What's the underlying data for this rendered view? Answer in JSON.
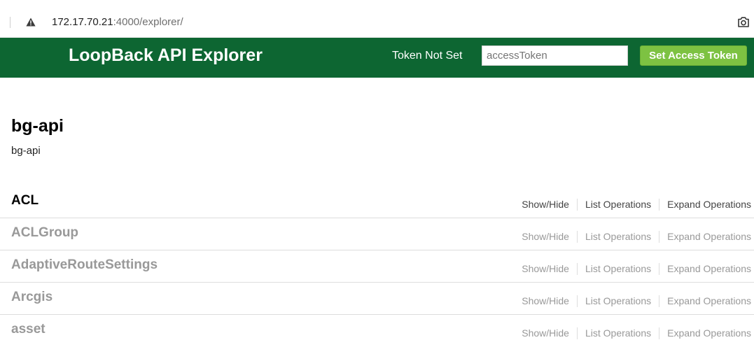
{
  "browser": {
    "url_host": "172.17.70.21",
    "url_rest": ":4000/explorer/"
  },
  "header": {
    "title": "LoopBack API Explorer",
    "token_status": "Token Not Set",
    "token_input_placeholder": "accessToken",
    "token_button_label": "Set Access Token",
    "bg_color": "#0d6632",
    "button_color": "#7dc242"
  },
  "api": {
    "title": "bg-api",
    "description": "bg-api"
  },
  "resources": [
    {
      "name": "ACL",
      "show_hide": "Show/Hide",
      "list_ops": "List Operations",
      "expand_ops": "Expand Operations"
    },
    {
      "name": "ACLGroup",
      "show_hide": "Show/Hide",
      "list_ops": "List Operations",
      "expand_ops": "Expand Operations"
    },
    {
      "name": "AdaptiveRouteSettings",
      "show_hide": "Show/Hide",
      "list_ops": "List Operations",
      "expand_ops": "Expand Operations"
    },
    {
      "name": "Arcgis",
      "show_hide": "Show/Hide",
      "list_ops": "List Operations",
      "expand_ops": "Expand Operations"
    },
    {
      "name": "asset",
      "show_hide": "Show/Hide",
      "list_ops": "List Operations",
      "expand_ops": "Expand Operations"
    }
  ]
}
